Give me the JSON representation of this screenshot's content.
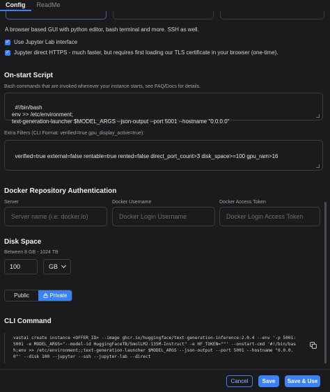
{
  "tabs": [
    {
      "label": "Config",
      "active": true
    },
    {
      "label": "ReadMe",
      "active": false
    }
  ],
  "description": "A browser based GUI with python editor, bash terminal and more. SSH as well.",
  "checkboxes": [
    {
      "label": "Use Jupyter Lab interface",
      "checked": true
    },
    {
      "label": "Jupyter direct HTTPS - much faster, but requires first loading our TLS certificate in your browser (one-time).",
      "checked": true
    }
  ],
  "onstart": {
    "title": "On-start Script",
    "helper": "Bash commands that are invoked whenever your instance starts, see FAQ/Docs for details.",
    "value": "#!/bin/bash\nenv >> /etc/environment;\ntext-generation-launcher $MODEL_ARGS --json-output --port 5001 --hostname \"0.0.0.0\""
  },
  "extra_filters": {
    "label": "Extra Filters (CLI Format: verified=true gpu_display_active=true):",
    "value": "verified=true external=false rentable=true rented=false direct_port_count>3 disk_space>=100 gpu_ram>16"
  },
  "docker_auth": {
    "title": "Docker Repository Authentication",
    "fields": [
      {
        "label": "Server",
        "placeholder": "Server name (i.e: docker.io)"
      },
      {
        "label": "Docker Username",
        "placeholder": "Docker Login Username"
      },
      {
        "label": "Docker Access Token",
        "placeholder": "Docker Login Access Token"
      }
    ]
  },
  "disk": {
    "title": "Disk Space",
    "range": "Between 8 GB - 1024 TB",
    "value": "100",
    "unit": "GB"
  },
  "visibility": {
    "options": [
      "Public",
      "Private"
    ],
    "selected": "Private"
  },
  "cli": {
    "title": "CLI Command",
    "command": "vastai create instance <OFFER_ID> --image ghcr.io/huggingface/text-generation-inference:2.0.4 --env '-p 5001:5001 -e MODEL_ARGS=\"--model-id HuggingFaceTB/SmolLM2-135M-Instruct\" -e HF_TOKEN=\"\"' --onstart-cmd '#!/bin/bash;env >> /etc/environment;;text-generation-launcher $MODEL_ARGS --json-output --port 5001 --hostname \"0.0.0.0\"' --disk 100 --jupyter --ssh --jupyter-lab --direct"
  },
  "buttons": {
    "cancel": "Cancel",
    "save": "Save",
    "save_use": "Save & Use"
  },
  "colors": {
    "accent": "#3b82f6",
    "background": "#1b1b1d"
  }
}
